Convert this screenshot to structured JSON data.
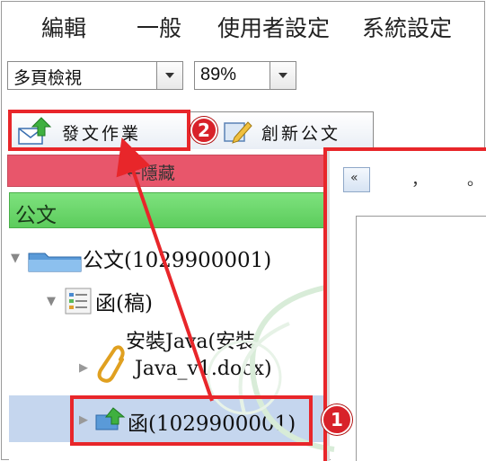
{
  "menu": {
    "items": [
      {
        "label": "編輯"
      },
      {
        "label": "一般"
      },
      {
        "label": "使用者設定"
      },
      {
        "label": "系統設定"
      }
    ]
  },
  "toolbar": {
    "view_select": "多頁檢視",
    "zoom_select": "89%"
  },
  "tabs": [
    {
      "label": "發文作業"
    },
    {
      "label": "創新公文"
    }
  ],
  "left_panel": {
    "hide_label": "←隱藏",
    "section_title": "公文",
    "tree": {
      "root_label": "公文(1029900001)",
      "folder_label": "函(稿)",
      "attachment_line1": "安裝Java(安裝",
      "attachment_line2": "Java_v1.docx)",
      "selected_label": "函(1029900001)"
    }
  },
  "right_panel": {
    "nav_button": "«",
    "punct1": "，",
    "punct2": "。"
  },
  "annotations": {
    "badge_1": "1",
    "badge_2": "2",
    "color": "#e8262a"
  },
  "colors": {
    "hide_bar": "#e8566b",
    "section_header": "#6cd86c",
    "selected_row": "#c5d6ee"
  }
}
